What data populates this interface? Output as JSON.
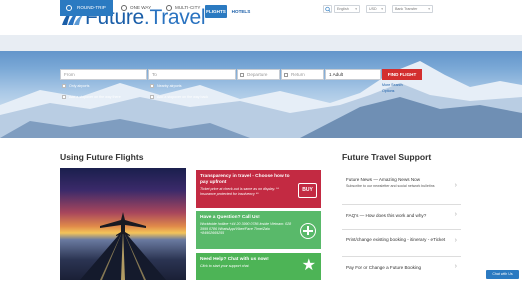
{
  "header": {
    "logo_text_main": "Future",
    "logo_text_accent": ".Travel",
    "nav": {
      "flights": "FLIGHTS",
      "hotels": "HOTELS"
    },
    "language": "English",
    "currency": "USD",
    "payment": "Bank Transfer"
  },
  "search": {
    "tabs": {
      "round_trip": "ROUND-TRIP",
      "one_way": "ONE WAY",
      "multi_city": "MULTI-CITY"
    },
    "from_placeholder": "From",
    "to_placeholder": "To",
    "departure_placeholder": "Departure",
    "return_placeholder": "Return",
    "passengers": "1 Adult",
    "find_button": "FIND FLIGHT",
    "checks": {
      "only_airports_1": "Only airports",
      "stopover_1": "Add a stopover on the way there",
      "nearby_airports": "Nearby airports",
      "stopover_2": "Add a stopover on the way back"
    },
    "more_search": "More Search",
    "options": "Options"
  },
  "using": {
    "title": "Using Future Flights",
    "cards": [
      {
        "title": "Transparency in travel - Choose how to pay upfront",
        "body": "Ticket price at check-out is same as on display. ** Insurance protected for insolvency **",
        "badge": "BUY"
      },
      {
        "title": "Have a Question? Call Us!",
        "body": "Worldwide hotline +44 20 3990 0786 Inside Vietnam: 028 3999 0786 WhatsApp/Viber/Face Time/Zalo +84902669255"
      },
      {
        "title": "Need Help? Chat with us now!",
        "body": "Click to start your support chat."
      }
    ]
  },
  "support": {
    "title": "Future Travel Support",
    "items": [
      {
        "label": "Future News — Amazing News Now",
        "sub": "Subscribe to our newsletter and social network bulletins"
      },
      {
        "label": "FAQ's — How does this work and why?"
      },
      {
        "label": "Print/change existing booking - itinerary - eTicket"
      },
      {
        "label": "Pay For or Change a Future Booking"
      }
    ]
  },
  "chat_button": "Chat with Us"
}
